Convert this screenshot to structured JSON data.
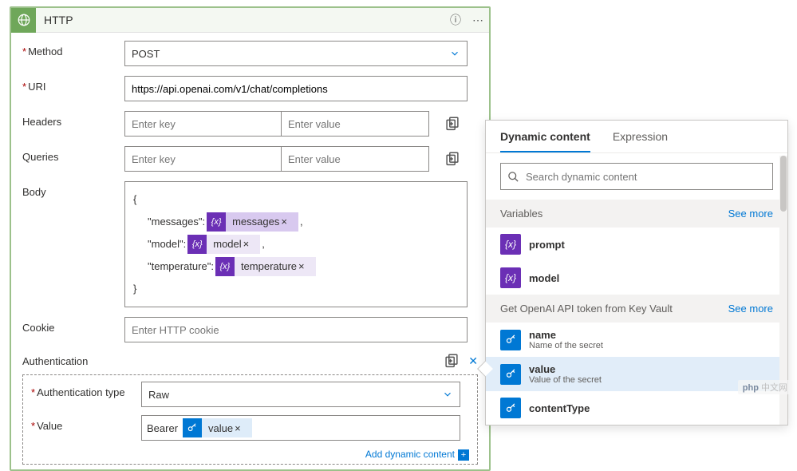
{
  "header": {
    "title": "HTTP"
  },
  "labels": {
    "method": "Method",
    "uri": "URI",
    "headers": "Headers",
    "queries": "Queries",
    "body": "Body",
    "cookie": "Cookie",
    "authentication": "Authentication",
    "authType": "Authentication type",
    "value": "Value"
  },
  "method": {
    "value": "POST"
  },
  "uri": {
    "value": "https://api.openai.com/v1/chat/completions"
  },
  "placeholders": {
    "key": "Enter key",
    "val": "Enter value",
    "cookie": "Enter HTTP cookie"
  },
  "body": {
    "open": "{",
    "line1_text": "\"messages\":",
    "line1_token": "messages",
    "line1_tail": ",",
    "line2_text": "\"model\":",
    "line2_token": "model",
    "line2_tail": ",",
    "line3_text": "\"temperature\":",
    "line3_token": "temperature",
    "close": "}"
  },
  "auth": {
    "type": "Raw",
    "valuePrefix": "Bearer",
    "valueToken": "value"
  },
  "addDynamic": "Add dynamic content",
  "dynPanel": {
    "tabDynamic": "Dynamic content",
    "tabExpression": "Expression",
    "searchPlaceholder": "Search dynamic content",
    "group1": "Variables",
    "seeMore": "See more",
    "item_prompt": "prompt",
    "item_model": "model",
    "group2": "Get OpenAI API token from Key Vault",
    "kv_name": "name",
    "kv_name_desc": "Name of the secret",
    "kv_value": "value",
    "kv_value_desc": "Value of the secret",
    "kv_contentType": "contentType"
  },
  "watermark": {
    "php": "php",
    "suffix": "中文网"
  }
}
